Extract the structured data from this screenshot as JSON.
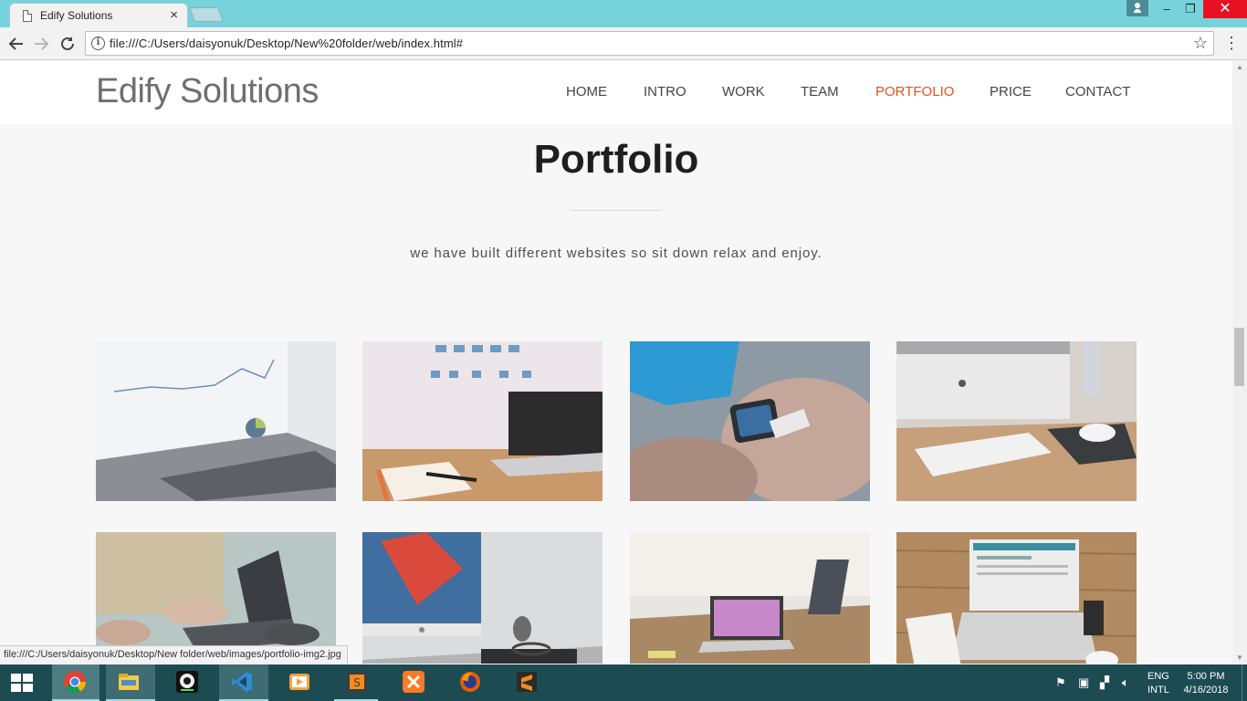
{
  "browser": {
    "tab_title": "Edify Solutions",
    "tab_close": "×",
    "url": "file:///C:/Users/daisyonuk/Desktop/New%20folder/web/index.html#",
    "status_url": "file:///C:/Users/daisyonuk/Desktop/New folder/web/images/portfolio-img2.jpg",
    "icons": [
      "document-icon",
      "back-arrow-icon",
      "forward-arrow-icon",
      "reload-icon",
      "info-icon",
      "star-icon",
      "menu-icon",
      "profile-icon"
    ],
    "window_controls": {
      "minimize": "–",
      "maximize": "❐",
      "close": "✕"
    }
  },
  "site": {
    "brand": "Edify Solutions",
    "nav": [
      {
        "label": "HOME"
      },
      {
        "label": "INTRO"
      },
      {
        "label": "WORK"
      },
      {
        "label": "TEAM"
      },
      {
        "label": "PORTFOLIO",
        "active": true
      },
      {
        "label": "PRICE"
      },
      {
        "label": "CONTACT"
      }
    ],
    "accent_color": "#e2531f",
    "portfolio": {
      "title": "Portfolio",
      "subtitle": "we have built different websites so sit down relax and enjoy.",
      "images": [
        "laptop with analytics charts",
        "laptop on desk in front of whiteboard",
        "hand with smartwatch",
        "iMac with keyboard and mouse",
        "hands typing on laptop",
        "iMac with glasses and mug",
        "laptop with feet on desk",
        "laptop with notebook and coffee"
      ]
    }
  },
  "taskbar": {
    "apps": [
      "windows-start-icon",
      "chrome-icon",
      "file-explorer-icon",
      "webcam-icon",
      "visual-studio-code-icon",
      "media-player-icon",
      "sublime-text-icon",
      "xampp-icon",
      "firefox-icon",
      "sublime-text-icon"
    ],
    "tray_icons": [
      "flag-icon",
      "network-icon",
      "wifi-icon",
      "volume-icon"
    ],
    "lang_line1": "ENG",
    "lang_line2": "INTL",
    "time": "5:00 PM",
    "date": "4/16/2018"
  }
}
